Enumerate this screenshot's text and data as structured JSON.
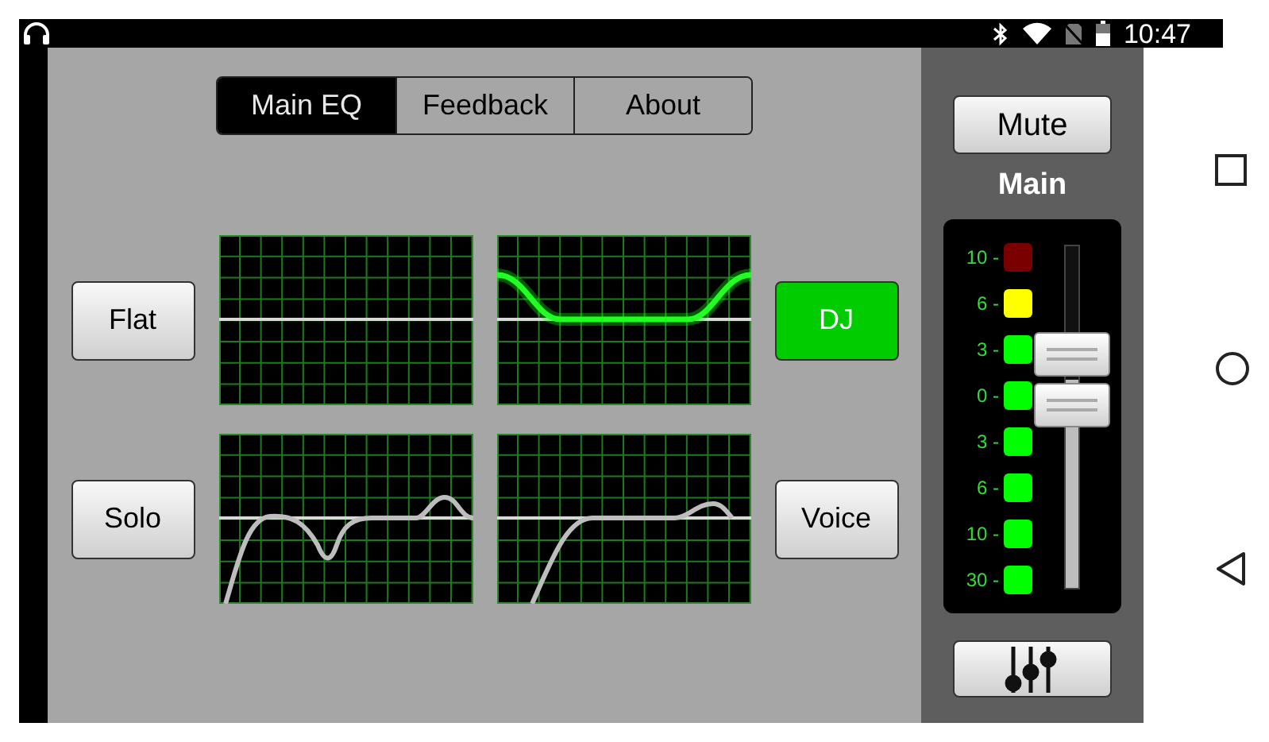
{
  "status_bar": {
    "time": "10:47"
  },
  "tabs": [
    {
      "label": "Main EQ",
      "selected": true
    },
    {
      "label": "Feedback",
      "selected": false
    },
    {
      "label": "About",
      "selected": false
    }
  ],
  "presets": [
    {
      "label": "Flat",
      "selected": false,
      "kind": "flat"
    },
    {
      "label": "DJ",
      "selected": true,
      "kind": "shelf"
    },
    {
      "label": "Solo",
      "selected": false,
      "kind": "dip"
    },
    {
      "label": "Voice",
      "selected": false,
      "kind": "highpass"
    }
  ],
  "mixer": {
    "mute_label": "Mute",
    "channel": "Main",
    "meter": [
      {
        "label": "10 -",
        "color": "#7a0000"
      },
      {
        "label": "6 -",
        "color": "#ffff00"
      },
      {
        "label": "3 -",
        "color": "#00ff00"
      },
      {
        "label": "0 -",
        "color": "#00ff00"
      },
      {
        "label": "3 -",
        "color": "#00ff00"
      },
      {
        "label": "6 -",
        "color": "#00ff00"
      },
      {
        "label": "10 -",
        "color": "#00ff00"
      },
      {
        "label": "30 -",
        "color": "#00ff00"
      }
    ],
    "fader": {
      "level": 0.61
    }
  }
}
